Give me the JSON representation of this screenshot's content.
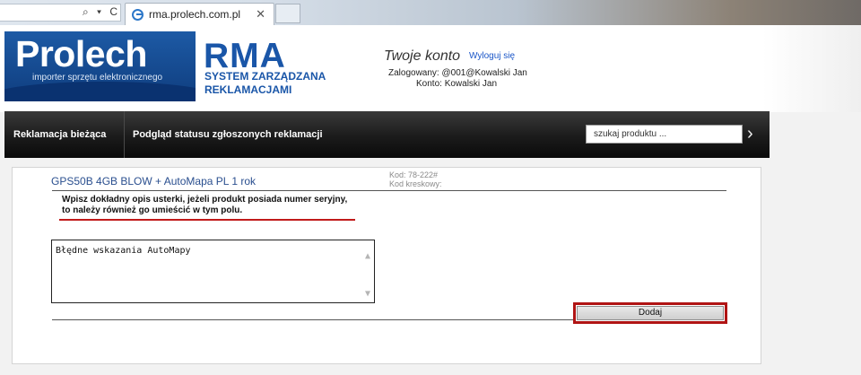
{
  "browser": {
    "tab_title": "rma.prolech.com.pl",
    "tab_close": "✕",
    "address_icons": "⌕ ▾ C"
  },
  "header": {
    "logo_text": "Prolech",
    "logo_tagline": "importer sprzętu elektronicznego",
    "rma_title": "RMA",
    "rma_subtitle_line1": "SYSTEM ZARZĄDZANA",
    "rma_subtitle_line2": "REKLAMACJAMI",
    "account_title": "Twoje konto",
    "logout_label": "Wyloguj się",
    "logged_in": "Zalogowany: @001@Kowalski Jan",
    "account": "Konto: Kowalski Jan"
  },
  "nav": {
    "items": [
      {
        "label": "Reklamacja bieżąca"
      },
      {
        "label": "Podgląd statusu zgłoszonych reklamacji"
      }
    ],
    "search_placeholder": "szukaj produktu ...",
    "search_arrow": "›"
  },
  "product": {
    "name": "GPS50B 4GB BLOW + AutoMapa PL 1 rok",
    "code": "Kod: 78-222#",
    "barcode": "Kod kreskowy:"
  },
  "form": {
    "instruction_line1": "Wpisz dokładny opis usterki, jeżeli produkt posiada numer seryjny,",
    "instruction_line2": "to należy również go umieścić w tym polu.",
    "description_value": "Błędne wskazania AutoMapy",
    "add_button": "Dodaj"
  },
  "colors": {
    "brand_blue": "#1a56a8",
    "highlight_red": "#b01414",
    "nav_bg": "#1b1b1b"
  }
}
